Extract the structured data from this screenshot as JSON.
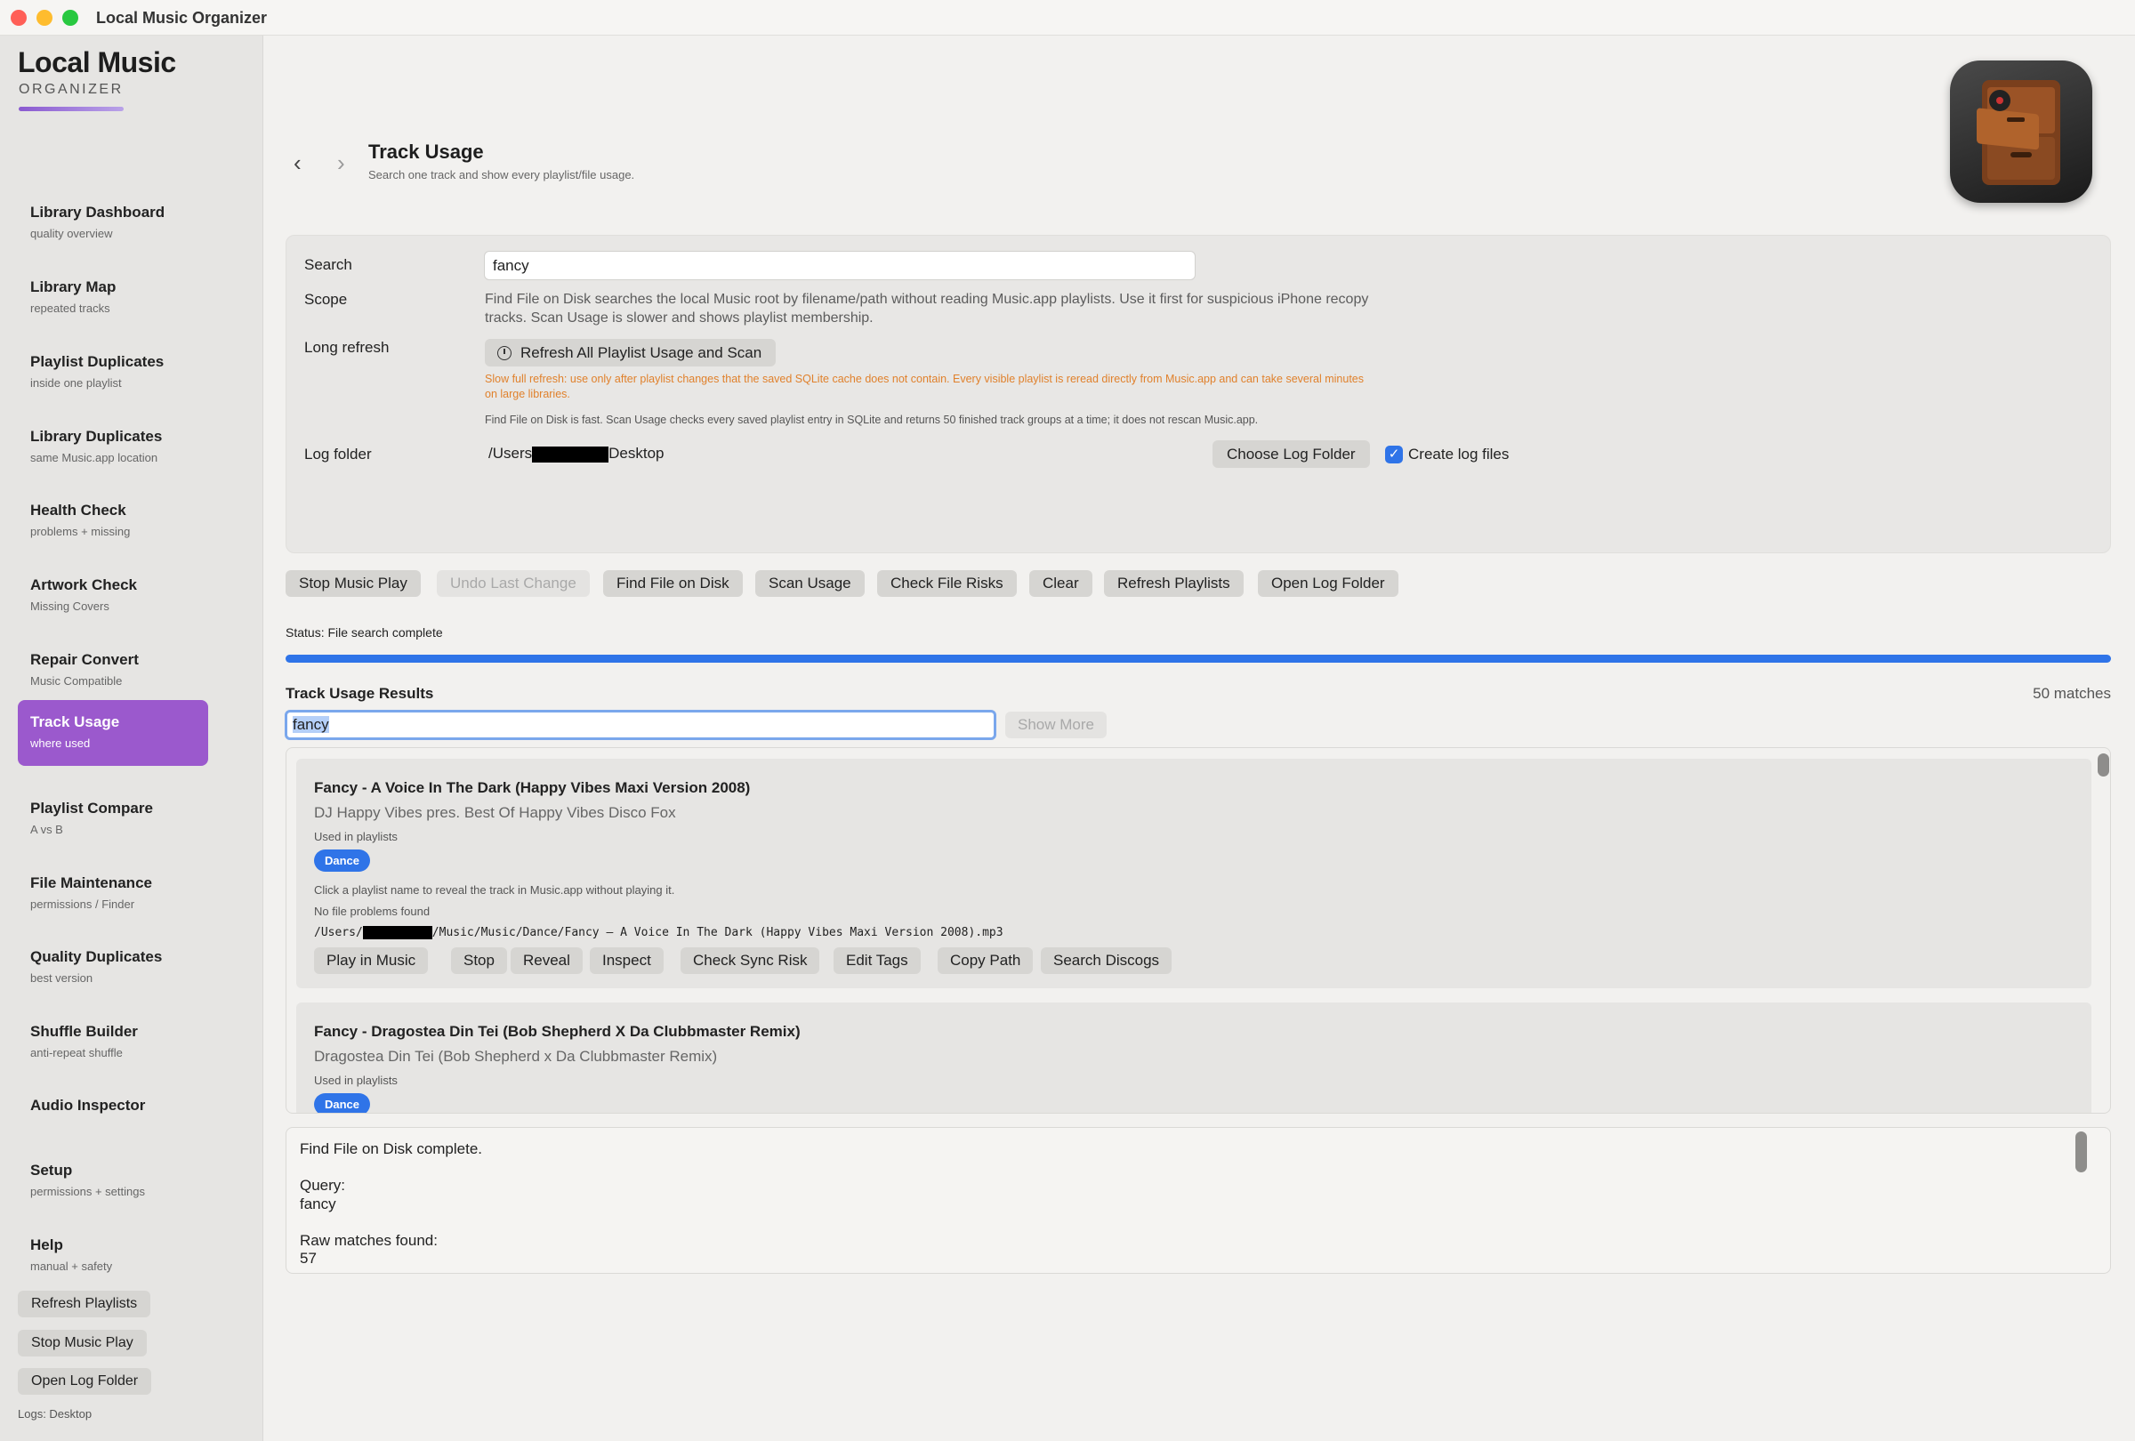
{
  "window": {
    "title": "Local Music Organizer"
  },
  "brand": {
    "title": "Local Music",
    "subtitle": "ORGANIZER"
  },
  "sidebar": {
    "items": [
      {
        "label": "Library Dashboard",
        "sub": "quality overview"
      },
      {
        "label": "Library Map",
        "sub": "repeated tracks"
      },
      {
        "label": "Playlist Duplicates",
        "sub": "inside one playlist"
      },
      {
        "label": "Library Duplicates",
        "sub": "same Music.app location"
      },
      {
        "label": "Health Check",
        "sub": "problems + missing"
      },
      {
        "label": "Artwork Check",
        "sub": "Missing Covers"
      },
      {
        "label": "Repair Convert",
        "sub": "Music Compatible"
      },
      {
        "label": "Track Usage",
        "sub": "where used"
      },
      {
        "label": "Playlist Compare",
        "sub": "A vs B"
      },
      {
        "label": "File Maintenance",
        "sub": "permissions / Finder"
      },
      {
        "label": "Quality Duplicates",
        "sub": "best version"
      },
      {
        "label": "Shuffle Builder",
        "sub": "anti-repeat shuffle"
      },
      {
        "label": "Audio Inspector",
        "sub": ""
      },
      {
        "label": "Setup",
        "sub": "permissions + settings"
      },
      {
        "label": "Help",
        "sub": "manual + safety"
      }
    ],
    "buttons": {
      "refresh": "Refresh Playlists",
      "stop": "Stop Music Play",
      "open_log": "Open Log Folder"
    },
    "logs_note": "Logs: Desktop"
  },
  "header": {
    "title": "Track Usage",
    "subtitle": "Search one track and show every playlist/file usage.",
    "back_icon": "‹",
    "forward_icon": "›"
  },
  "form": {
    "search_label": "Search",
    "search_value": "fancy",
    "scope_label": "Scope",
    "scope_text": "Find File on Disk searches the local Music root by filename/path without reading Music.app playlists. Use it first for suspicious iPhone recopy tracks. Scan Usage is slower and shows playlist membership.",
    "long_refresh_label": "Long refresh",
    "refresh_button": "Refresh All Playlist Usage and Scan",
    "warning": "Slow full refresh: use only after playlist changes that the saved SQLite cache does not contain. Every visible playlist is reread directly from Music.app and can take several minutes on large libraries.",
    "info": "Find File on Disk is fast. Scan Usage checks every saved playlist entry in SQLite and returns 50 finished track groups at a time; it does not rescan Music.app.",
    "log_folder_label": "Log folder",
    "log_path_prefix": "/Users",
    "log_path_suffix": "Desktop",
    "choose_button": "Choose Log Folder",
    "create_logs_label": "Create log files",
    "create_logs_checked": true,
    "check_glyph": "✓"
  },
  "toolbar": {
    "buttons": [
      "Stop Music Play",
      "Undo Last Change",
      "Find File on Disk",
      "Scan Usage",
      "Check File Risks",
      "Clear",
      "Refresh Playlists",
      "Open Log Folder"
    ],
    "disabled": [
      "Undo Last Change"
    ]
  },
  "status": "Status: File search complete",
  "progress": 1.0,
  "results": {
    "title": "Track Usage Results",
    "count": "50 matches",
    "filter_value": "fancy",
    "show_more": "Show More",
    "cards": [
      {
        "title": "Fancy - A Voice In The Dark (Happy Vibes Maxi Version 2008)",
        "artist": "DJ Happy Vibes pres. Best Of Happy Vibes Disco Fox",
        "used": "Used in playlists",
        "playlist": "Dance",
        "hint": "Click a playlist name to reveal the track in Music.app without playing it.",
        "problems": "No file problems found",
        "path_prefix": "/Users/",
        "path_suffix": "/Music/Music/Dance/Fancy – A Voice In The Dark (Happy Vibes Maxi Version 2008).mp3",
        "actions": [
          "Play in Music",
          "Stop",
          "Reveal",
          "Inspect",
          "Check Sync Risk",
          "Edit Tags",
          "Copy Path",
          "Search Discogs"
        ]
      },
      {
        "title": "Fancy - Dragostea Din Tei (Bob Shepherd X Da Clubbmaster Remix)",
        "artist": "Dragostea Din Tei (Bob Shepherd x Da Clubbmaster Remix)",
        "used": "Used in playlists",
        "playlist": "Dance"
      }
    ]
  },
  "log": {
    "lines": [
      "Find File on Disk complete.",
      "",
      "Query:",
      "fancy",
      "",
      "Raw matches found:",
      "57"
    ]
  },
  "colors": {
    "accent": "#2f74e8",
    "active_nav": "#9b59cd",
    "warning": "#e0812c"
  }
}
